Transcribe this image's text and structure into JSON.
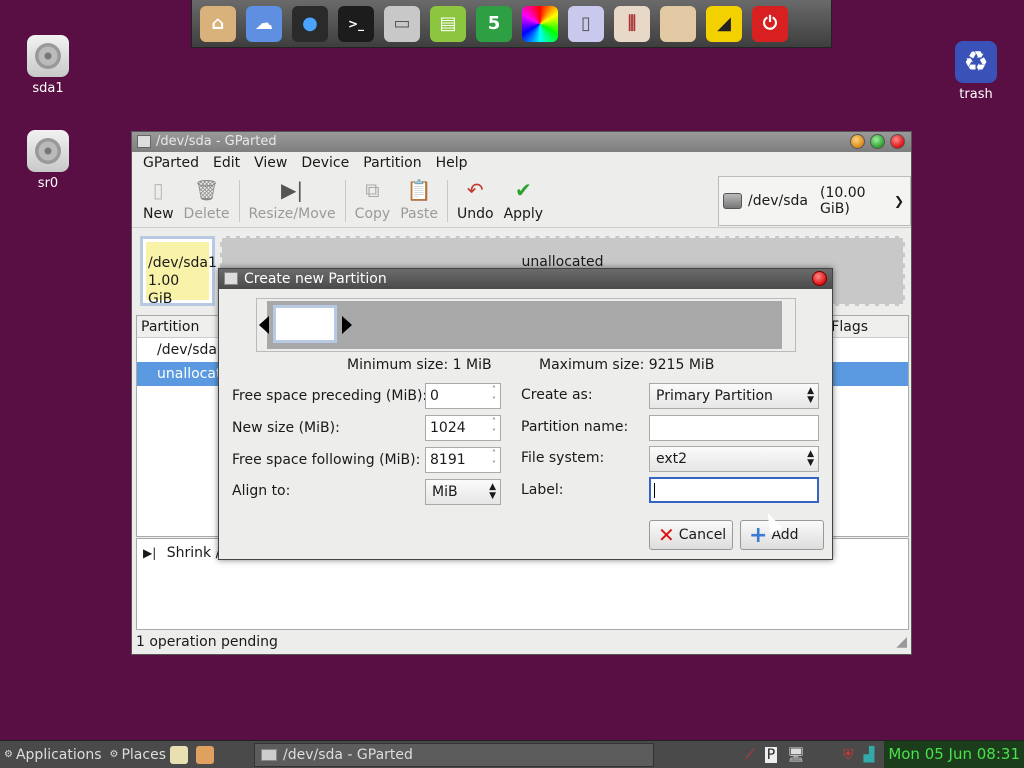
{
  "desktop": {
    "icons": [
      {
        "label": "sda1"
      },
      {
        "label": "sr0"
      },
      {
        "label": "trash"
      }
    ]
  },
  "dock": {
    "items": [
      "home-folder",
      "cloud",
      "chat",
      "terminal",
      "monitor",
      "document-editor",
      "spreadsheet",
      "color-picker",
      "text-editor",
      "settings",
      "folder",
      "brightness",
      "power"
    ]
  },
  "window": {
    "title": "/dev/sda - GParted",
    "menu": [
      "GParted",
      "Edit",
      "View",
      "Device",
      "Partition",
      "Help"
    ],
    "toolbar": {
      "new": "New",
      "delete": "Delete",
      "resize_move": "Resize/Move",
      "copy": "Copy",
      "paste": "Paste",
      "undo": "Undo",
      "apply": "Apply"
    },
    "device": {
      "name": "/dev/sda",
      "size": "(10.00 GiB)"
    },
    "map": {
      "sda1_name": "/dev/sda1",
      "sda1_size": "1.00 GiB",
      "unallocated": "unallocated"
    },
    "list": {
      "col_partition": "Partition",
      "col_flags": "Flags",
      "rows": [
        "/dev/sda1",
        "unallocat"
      ]
    },
    "operations": {
      "item": "Shrink /d"
    },
    "status": "1 operation pending"
  },
  "dialog": {
    "title": "Create new Partition",
    "min_size": "Minimum size: 1 MiB",
    "max_size": "Maximum size: 9215 MiB",
    "free_preceding_label": "Free space preceding (MiB):",
    "free_preceding_value": "0",
    "new_size_label": "New size (MiB):",
    "new_size_value": "1024",
    "free_following_label": "Free space following (MiB):",
    "free_following_value": "8191",
    "align_label": "Align to:",
    "align_value": "MiB",
    "create_as_label": "Create as:",
    "create_as_value": "Primary Partition",
    "partition_name_label": "Partition name:",
    "partition_name_value": "",
    "file_system_label": "File system:",
    "file_system_value": "ext2",
    "label_label": "Label:",
    "label_value": "",
    "cancel": "Cancel",
    "add": "Add"
  },
  "taskbar": {
    "applications": "Applications",
    "places": "Places",
    "task": "/dev/sda - GParted",
    "clock": "Mon 05 Jun 08:31"
  },
  "colors": {
    "desktop": "#5a0f44",
    "selection": "#5b9ae0",
    "clock_text": "#4ce04c"
  }
}
